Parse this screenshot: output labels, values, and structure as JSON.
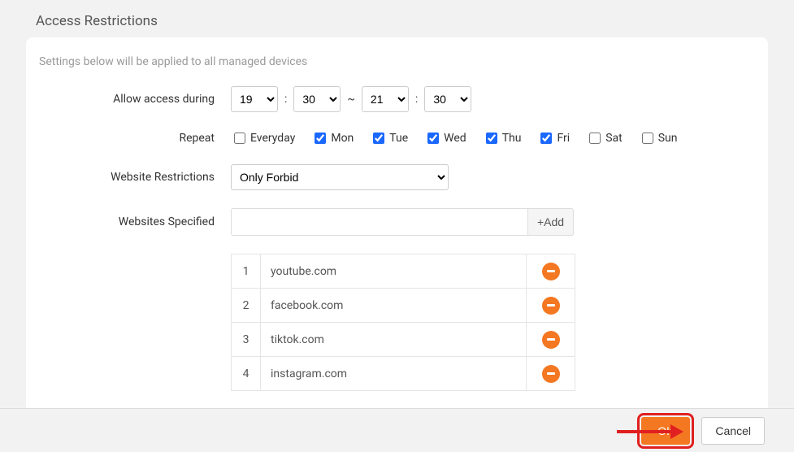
{
  "title": "Access Restrictions",
  "hint": "Settings below will be applied to all managed devices",
  "labels": {
    "allow_access": "Allow access during",
    "repeat": "Repeat",
    "restrictions": "Website Restrictions",
    "specified": "Websites Specified"
  },
  "time": {
    "from_h": "19",
    "from_m": "30",
    "to_h": "21",
    "to_m": "30",
    "tilde": "~",
    "colon": ":"
  },
  "days": [
    {
      "label": "Everyday",
      "checked": false
    },
    {
      "label": "Mon",
      "checked": true
    },
    {
      "label": "Tue",
      "checked": true
    },
    {
      "label": "Wed",
      "checked": true
    },
    {
      "label": "Thu",
      "checked": true
    },
    {
      "label": "Fri",
      "checked": true
    },
    {
      "label": "Sat",
      "checked": false
    },
    {
      "label": "Sun",
      "checked": false
    }
  ],
  "restriction_mode": "Only Forbid",
  "add_button": "+Add",
  "sites": [
    {
      "n": "1",
      "url": "youtube.com"
    },
    {
      "n": "2",
      "url": "facebook.com"
    },
    {
      "n": "3",
      "url": "tiktok.com"
    },
    {
      "n": "4",
      "url": "instagram.com"
    }
  ],
  "buttons": {
    "ok": "OK",
    "cancel": "Cancel"
  }
}
